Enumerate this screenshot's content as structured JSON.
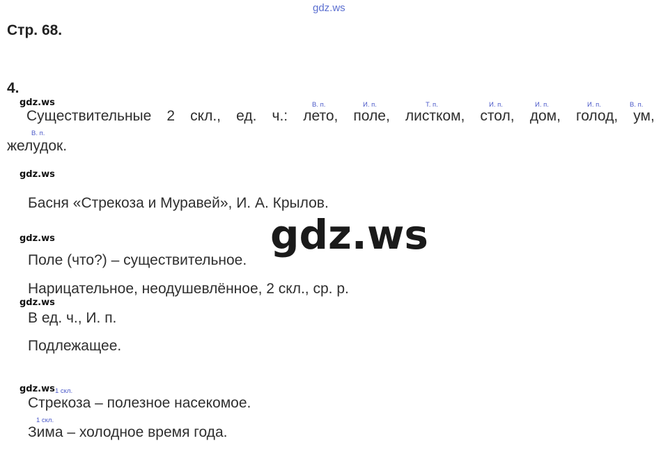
{
  "watermark_top": "gdz.ws",
  "page_label": "Стр. 68.",
  "task_label": "4.",
  "watermark_small": "gdz.ws",
  "watermark_big": "gdz.ws",
  "sentence1": {
    "words": [
      "Существительные",
      "2",
      "скл.,",
      "ед.",
      "ч.:",
      "лето,",
      "поле,",
      "листком,",
      "стол,",
      "дом,",
      "голод,",
      "ум,"
    ],
    "line2": "желудок."
  },
  "case_marks": {
    "leto": "В. п.",
    "pole": "И. п.",
    "listkom": "Т. п.",
    "stol": "И. п.",
    "dom": "И. п.",
    "golod": "И. п.",
    "um": "В. п.",
    "zheludok": "В. п."
  },
  "fable_line": "Басня «Стрекоза и Муравей», И. А. Крылов.",
  "analysis": {
    "line1": "Поле (что?) – существительное.",
    "line2": "Нарицательное, неодушевлённое, 2 скл., ср. р.",
    "line3": "В ед. ч., И. п.",
    "line4": "Подлежащее."
  },
  "declension_mark_1": "1 скл.",
  "declension_mark_2": "1 скл.",
  "sentence_strekoza": "Стрекоза – полезное насекомое.",
  "sentence_zima": "Зима – холодное время года."
}
